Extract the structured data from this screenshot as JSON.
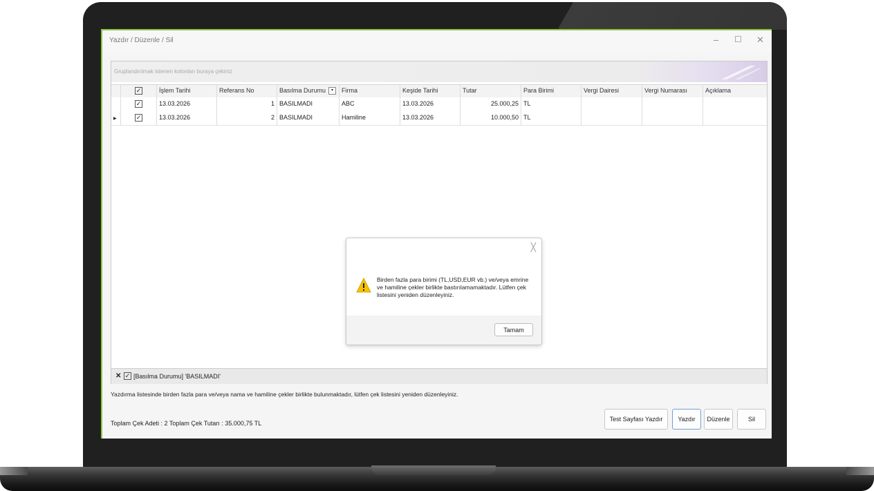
{
  "window": {
    "title": "Yazdır / Düzenle  / Sil"
  },
  "grid": {
    "group_panel_hint": "Gruplandırılmak istenen kolonları buraya çekiniz",
    "columns": [
      "İşlem Tarihi",
      "Referans No",
      "Basılma Durumu",
      "Firma",
      "Keşide Tarihi",
      "Tutar",
      "Para Birimi",
      "Vergi Dairesi",
      "Vergi Numarası",
      "Açıklama"
    ],
    "rows": [
      {
        "checked": true,
        "islem_tarihi": "13.03.2026",
        "referans_no": "1",
        "basilma_durumu": "BASILMADI",
        "firma": "ABC",
        "keside_tarihi": "13.03.2026",
        "tutar": "25.000,25",
        "para_birimi": "TL",
        "vergi_dairesi": "",
        "vergi_numarasi": "",
        "aciklama": ""
      },
      {
        "checked": true,
        "islem_tarihi": "13.03.2026",
        "referans_no": "2",
        "basilma_durumu": "BASILMADI",
        "firma": "Hamiline",
        "keside_tarihi": "13.03.2026",
        "tutar": "10.000,50",
        "para_birimi": "TL",
        "vergi_dairesi": "",
        "vergi_numarasi": "",
        "aciklama": ""
      }
    ],
    "filter_text": "[Basılma Durumu]  'BASILMADI'"
  },
  "status": {
    "warning_line": "Yazdırma listesinde birden fazla para ve/veya nama ve hamiline çekler birlikte bulunmaktadır, lütfen çek listesini yeniden düzenleyiniz.",
    "totals": "Toplam Çek Adeti : 2 Toplam Çek Tutarı : 35.000,75 TL"
  },
  "buttons": {
    "test_print": "Test Sayfası Yazdır",
    "print": "Yazdır",
    "edit": "Düzenle",
    "delete": "Sil"
  },
  "dialog": {
    "message": "Birden fazla para birimi (TL,USD,EUR vb.) ve/veya emrine ve hamiline çekler birlikte bastırılamamaktadır. Lütfen çek listesini yeniden düzenleyiniz.",
    "ok_label": "Tamam",
    "icon": "warning-icon"
  },
  "colors": {
    "accent_green": "#8cc63f",
    "warning_yellow": "#f5c200"
  }
}
